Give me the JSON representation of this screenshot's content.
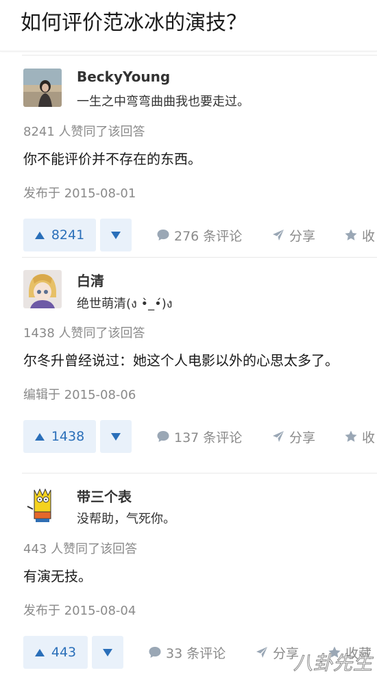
{
  "question": {
    "title": "如何评价范冰冰的演技？"
  },
  "answers": [
    {
      "author": "BeckyYoung",
      "bio": "一生之中弯弯曲曲我也要走过。",
      "votes_text": "8241 人赞同了该回答",
      "content": "你不能评价并不存在的东西。",
      "date": "发布于 2015-08-01",
      "upvote_count": "8241",
      "comments": "276 条评论",
      "share": "分享",
      "collect": "收"
    },
    {
      "author": "白清",
      "bio": "绝世萌清(ง •̀_•́)ง",
      "votes_text": "1438 人赞同了该回答",
      "content": "尔冬升曾经说过：她这个人电影以外的心思太多了。",
      "date": "编辑于 2015-08-06",
      "upvote_count": "1438",
      "comments": "137 条评论",
      "share": "分享",
      "collect": "收"
    },
    {
      "author": "带三个表",
      "bio": "没帮助，气死你。",
      "votes_text": "443 人赞同了该回答",
      "content": "有演无技。",
      "date": "发布于 2015-08-04",
      "upvote_count": "443",
      "comments": "33 条评论",
      "share": "分享",
      "collect": "收藏"
    }
  ],
  "watermark": "八卦先生",
  "colors": {
    "accent": "#2a6fb9",
    "vote_bg": "#e9f1fa",
    "meta_gray": "#8a8a8a"
  }
}
